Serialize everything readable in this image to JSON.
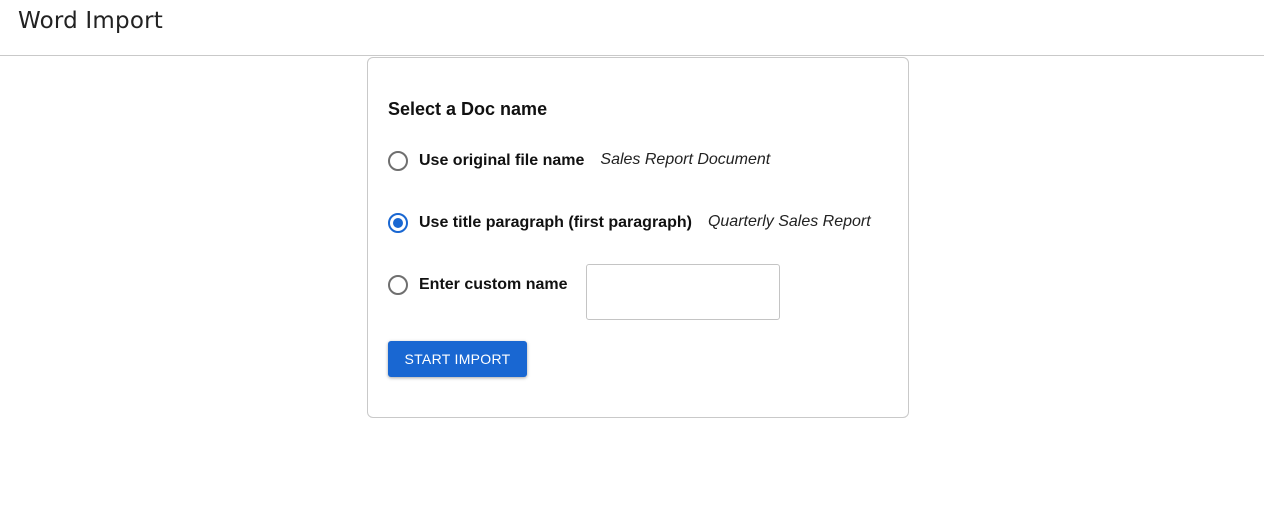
{
  "header": {
    "title": "Word Import"
  },
  "form": {
    "section_title": "Select a Doc name",
    "options": [
      {
        "label": "Use original file name",
        "hint": "Sales Report Document",
        "selected": false
      },
      {
        "label": "Use title paragraph (first paragraph)",
        "hint": "Quarterly Sales Report",
        "selected": true
      },
      {
        "label": "Enter custom name",
        "value": "",
        "selected": false
      }
    ],
    "start_button_label": "START IMPORT"
  },
  "colors": {
    "accent": "#1967d2",
    "border": "#c9c9c9"
  }
}
